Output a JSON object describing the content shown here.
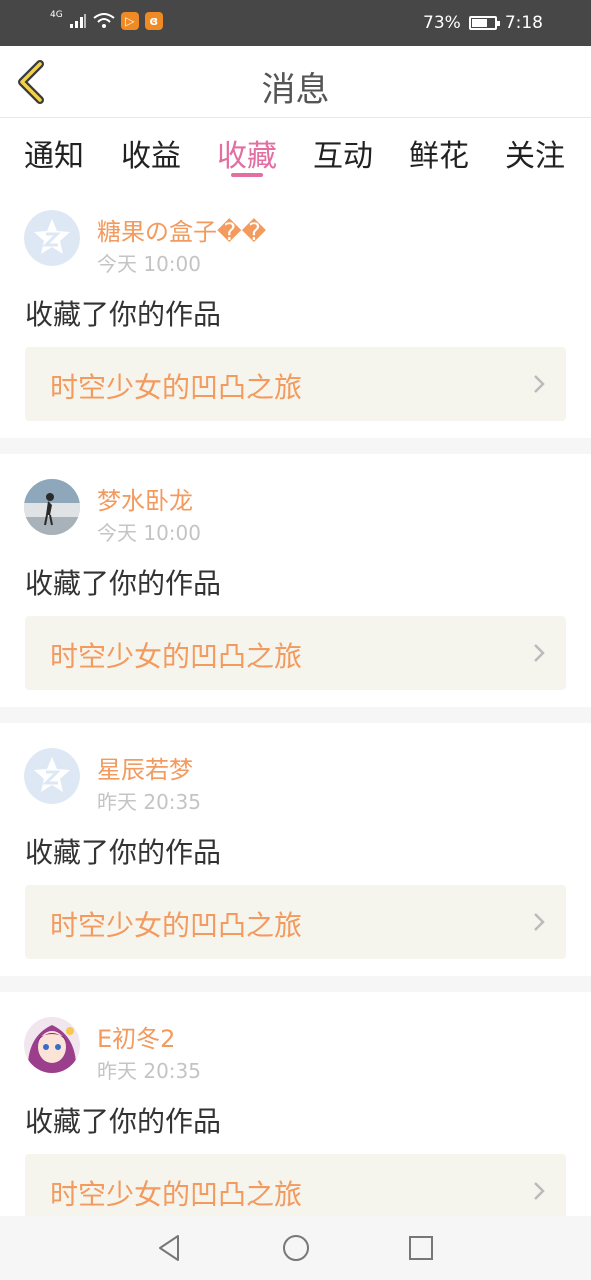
{
  "status_bar": {
    "network": "4G",
    "battery_percent": "73%",
    "battery_level": 0.73,
    "time": "7:18",
    "icons": [
      "signal-icon",
      "wifi-icon",
      "video-app-icon",
      "uc-app-icon"
    ]
  },
  "header": {
    "title": "消息",
    "back_icon": "back-chevron-icon"
  },
  "tabs": [
    {
      "label": "通知",
      "active": false
    },
    {
      "label": "收益",
      "active": false
    },
    {
      "label": "收藏",
      "active": true
    },
    {
      "label": "互动",
      "active": false
    },
    {
      "label": "鲜花",
      "active": false
    },
    {
      "label": "关注",
      "active": false
    }
  ],
  "colors": {
    "accent_pink": "#e36ea2",
    "accent_orange": "#f39a5e",
    "status_bar": "#474747"
  },
  "messages": [
    {
      "name": "糖果の盒子��",
      "time": "今天 10:00",
      "action": "收藏了你的作品",
      "work_title": "时空少女的凹凸之旅",
      "avatar": "default-q-avatar"
    },
    {
      "name": "梦水卧龙",
      "time": "今天 10:00",
      "action": "收藏了你的作品",
      "work_title": "时空少女的凹凸之旅",
      "avatar": "photo-avatar"
    },
    {
      "name": "星辰若梦",
      "time": "昨天 20:35",
      "action": "收藏了你的作品",
      "work_title": "时空少女的凹凸之旅",
      "avatar": "default-q-avatar"
    },
    {
      "name": "E初冬2",
      "time": "昨天 20:35",
      "action": "收藏了你的作品",
      "work_title": "时空少女的凹凸之旅",
      "avatar": "anime-avatar"
    }
  ],
  "nav_bar": {
    "back": "nav-back-icon",
    "home": "nav-home-icon",
    "recents": "nav-recents-icon"
  }
}
